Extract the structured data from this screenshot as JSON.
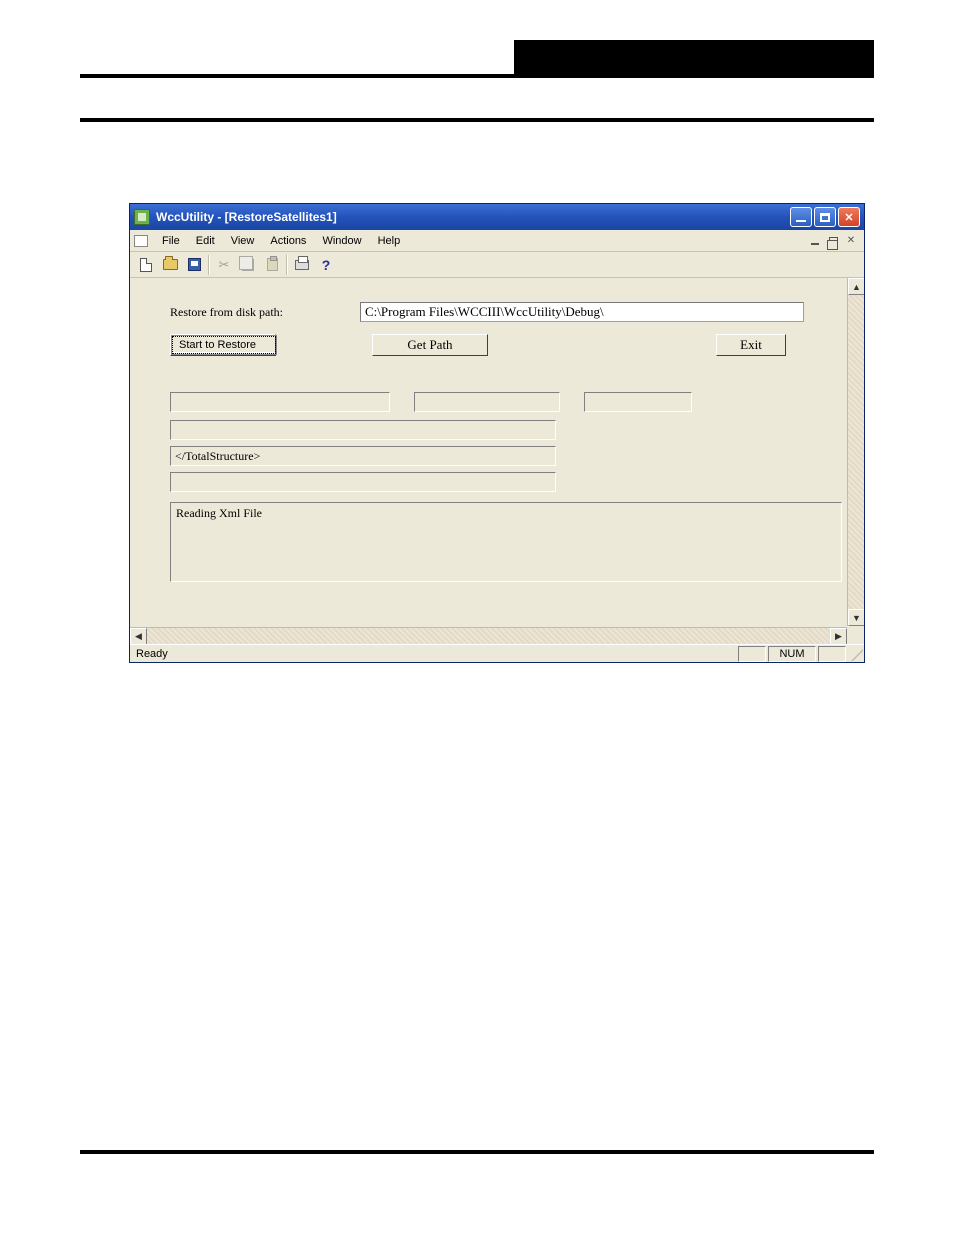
{
  "window": {
    "title": "WccUtility - [RestoreSatellites1]"
  },
  "menu": {
    "file": "File",
    "edit": "Edit",
    "view": "View",
    "actions": "Actions",
    "window": "Window",
    "help": "Help"
  },
  "form": {
    "path_label": "Restore from disk path:",
    "path_value": "C:\\Program Files\\WCCIII\\WccUtility\\Debug\\",
    "start_btn": "Start to Restore",
    "getpath_btn": "Get Path",
    "exit_btn": "Exit"
  },
  "status_fields": {
    "progress1": "",
    "progress2": "",
    "progress3": "",
    "line_a": "",
    "line_b": "</TotalStructure>",
    "line_c": "",
    "log": "Reading Xml File"
  },
  "statusbar": {
    "ready": "Ready",
    "num": "NUM"
  }
}
